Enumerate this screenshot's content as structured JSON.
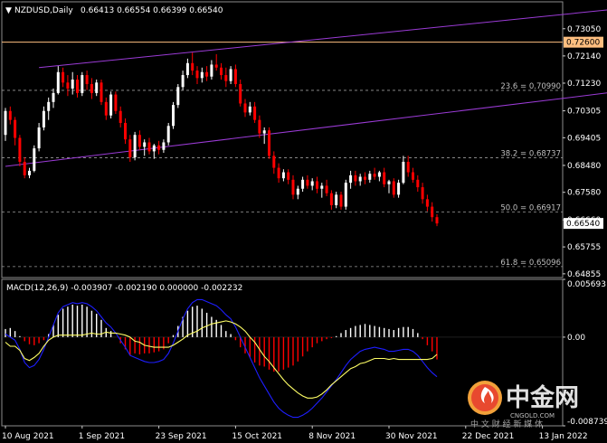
{
  "header": {
    "symbol": "NZDUSD,Daily",
    "ohlc": "0.66413 0.66554 0.66399 0.66540"
  },
  "macd_header": "MACD(12,26,9) -0.003907 -0.002190 0.000000 -0.002232",
  "colors": {
    "background": "#000000",
    "grid": "#5a5a5a",
    "bull": "#ffffff",
    "bear": "#ff0000",
    "channel": "#9b3bd6",
    "level": "#ffbf80",
    "macd_line": "#1e1eff",
    "signal_line": "#ffff66"
  },
  "watermark": {
    "brand_cn": "中金网",
    "brand_en": "CNGOLD.COM",
    "slogan": "中 文 财 经 新 媒 体",
    "icon": "flame-logo-icon"
  },
  "chart_data": {
    "type": "candlestick",
    "symbol": "NZDUSD",
    "timeframe": "Daily",
    "price_axis": {
      "ylim": [
        0.6473,
        0.7395
      ],
      "ticks": [
        "0.73050",
        "0.72140",
        "0.71230",
        "0.70305",
        "0.69405",
        "0.68480",
        "0.67580",
        "0.66660",
        "0.65755",
        "0.64855"
      ]
    },
    "current_price_label": "0.66540",
    "current_price": 0.6654,
    "level_line": {
      "label": "0.72600",
      "value": 0.726
    },
    "fibonacci": [
      {
        "label": "23.6 = 0.70990",
        "value": 0.7099
      },
      {
        "label": "38.2 = 0.68737",
        "value": 0.68737
      },
      {
        "label": "50.0 = 0.66917",
        "value": 0.66917
      },
      {
        "label": "61.8 = 0.65096",
        "value": 0.65096
      }
    ],
    "x_axis": {
      "labels": [
        "10 Aug 2021",
        "1 Sep 2021",
        "23 Sep 2021",
        "15 Oct 2021",
        "8 Nov 2021",
        "30 Nov 2021",
        "22 Dec 2021",
        "13 Jan 2022"
      ],
      "label_bars": [
        0,
        16,
        32,
        48,
        64,
        80,
        96,
        112
      ]
    },
    "channel": {
      "upper": [
        [
          7,
          0.7175
        ],
        [
          133,
          0.738
        ]
      ],
      "lower": [
        [
          0,
          0.6845
        ],
        [
          133,
          0.7105
        ]
      ]
    },
    "candles": [
      [
        0.695,
        0.704,
        0.693,
        0.703
      ],
      [
        0.703,
        0.7045,
        0.6985,
        0.7
      ],
      [
        0.7,
        0.701,
        0.6915,
        0.694
      ],
      [
        0.694,
        0.695,
        0.6845,
        0.686
      ],
      [
        0.686,
        0.6875,
        0.6805,
        0.6815
      ],
      [
        0.6815,
        0.684,
        0.6805,
        0.683
      ],
      [
        0.683,
        0.6915,
        0.6825,
        0.6905
      ],
      [
        0.6905,
        0.699,
        0.6895,
        0.6975
      ],
      [
        0.6975,
        0.7045,
        0.6965,
        0.703
      ],
      [
        0.703,
        0.7075,
        0.7,
        0.706
      ],
      [
        0.706,
        0.7105,
        0.704,
        0.709
      ],
      [
        0.709,
        0.718,
        0.7085,
        0.716
      ],
      [
        0.716,
        0.7175,
        0.711,
        0.7125
      ],
      [
        0.7125,
        0.715,
        0.708,
        0.7105
      ],
      [
        0.7105,
        0.716,
        0.7085,
        0.7135
      ],
      [
        0.7135,
        0.715,
        0.7075,
        0.709
      ],
      [
        0.709,
        0.716,
        0.708,
        0.715
      ],
      [
        0.715,
        0.7165,
        0.71,
        0.712
      ],
      [
        0.712,
        0.714,
        0.707,
        0.709
      ],
      [
        0.709,
        0.7135,
        0.708,
        0.7125
      ],
      [
        0.7125,
        0.7135,
        0.705,
        0.706
      ],
      [
        0.706,
        0.7075,
        0.7,
        0.7015
      ],
      [
        0.7015,
        0.7095,
        0.7005,
        0.7085
      ],
      [
        0.7085,
        0.7095,
        0.702,
        0.703
      ],
      [
        0.703,
        0.7045,
        0.6975,
        0.699
      ],
      [
        0.699,
        0.7005,
        0.692,
        0.6935
      ],
      [
        0.6935,
        0.695,
        0.686,
        0.6875
      ],
      [
        0.6875,
        0.696,
        0.6865,
        0.695
      ],
      [
        0.695,
        0.6965,
        0.69,
        0.691
      ],
      [
        0.691,
        0.6935,
        0.688,
        0.6925
      ],
      [
        0.6925,
        0.694,
        0.6885,
        0.6895
      ],
      [
        0.6895,
        0.692,
        0.687,
        0.6915
      ],
      [
        0.6915,
        0.693,
        0.6885,
        0.69
      ],
      [
        0.69,
        0.6935,
        0.689,
        0.6925
      ],
      [
        0.6925,
        0.699,
        0.6915,
        0.698
      ],
      [
        0.698,
        0.706,
        0.697,
        0.705
      ],
      [
        0.705,
        0.712,
        0.704,
        0.711
      ],
      [
        0.711,
        0.7165,
        0.71,
        0.715
      ],
      [
        0.715,
        0.7205,
        0.714,
        0.719
      ],
      [
        0.719,
        0.7225,
        0.715,
        0.7165
      ],
      [
        0.7165,
        0.718,
        0.712,
        0.714
      ],
      [
        0.714,
        0.7175,
        0.7125,
        0.716
      ],
      [
        0.716,
        0.718,
        0.713,
        0.7145
      ],
      [
        0.7145,
        0.72,
        0.7135,
        0.7185
      ],
      [
        0.7185,
        0.722,
        0.7165,
        0.7175
      ],
      [
        0.7175,
        0.719,
        0.7135,
        0.715
      ],
      [
        0.715,
        0.7175,
        0.711,
        0.713
      ],
      [
        0.713,
        0.718,
        0.712,
        0.717
      ],
      [
        0.717,
        0.7185,
        0.711,
        0.712
      ],
      [
        0.712,
        0.7135,
        0.7045,
        0.7055
      ],
      [
        0.7055,
        0.707,
        0.701,
        0.7025
      ],
      [
        0.7025,
        0.706,
        0.7015,
        0.7045
      ],
      [
        0.7045,
        0.706,
        0.699,
        0.7
      ],
      [
        0.7,
        0.7015,
        0.694,
        0.6955
      ],
      [
        0.6955,
        0.6975,
        0.692,
        0.6965
      ],
      [
        0.6965,
        0.6975,
        0.687,
        0.688
      ],
      [
        0.688,
        0.6895,
        0.682,
        0.684
      ],
      [
        0.684,
        0.6855,
        0.679,
        0.6805
      ],
      [
        0.6805,
        0.6835,
        0.6795,
        0.6825
      ],
      [
        0.6825,
        0.6835,
        0.6785,
        0.68
      ],
      [
        0.68,
        0.6815,
        0.6735,
        0.675
      ],
      [
        0.675,
        0.678,
        0.6735,
        0.677
      ],
      [
        0.677,
        0.681,
        0.676,
        0.68
      ],
      [
        0.68,
        0.6815,
        0.677,
        0.678
      ],
      [
        0.678,
        0.6805,
        0.6765,
        0.6795
      ],
      [
        0.6795,
        0.681,
        0.6755,
        0.677
      ],
      [
        0.677,
        0.679,
        0.674,
        0.678
      ],
      [
        0.678,
        0.68,
        0.6745,
        0.6755
      ],
      [
        0.6755,
        0.6765,
        0.67,
        0.6715
      ],
      [
        0.6715,
        0.676,
        0.6705,
        0.675
      ],
      [
        0.675,
        0.676,
        0.67,
        0.671
      ],
      [
        0.671,
        0.68,
        0.67,
        0.679
      ],
      [
        0.679,
        0.683,
        0.677,
        0.6815
      ],
      [
        0.6815,
        0.683,
        0.678,
        0.6795
      ],
      [
        0.6795,
        0.682,
        0.678,
        0.681
      ],
      [
        0.681,
        0.6825,
        0.6785,
        0.68
      ],
      [
        0.68,
        0.683,
        0.679,
        0.682
      ],
      [
        0.682,
        0.684,
        0.68,
        0.681
      ],
      [
        0.681,
        0.683,
        0.6795,
        0.6825
      ],
      [
        0.6825,
        0.684,
        0.6775,
        0.6785
      ],
      [
        0.6785,
        0.68,
        0.6755,
        0.6795
      ],
      [
        0.6795,
        0.6805,
        0.674,
        0.675
      ],
      [
        0.675,
        0.68,
        0.674,
        0.679
      ],
      [
        0.679,
        0.688,
        0.6785,
        0.686
      ],
      [
        0.686,
        0.688,
        0.681,
        0.6825
      ],
      [
        0.6825,
        0.684,
        0.679,
        0.68
      ],
      [
        0.68,
        0.6815,
        0.676,
        0.6775
      ],
      [
        0.6775,
        0.679,
        0.672,
        0.6735
      ],
      [
        0.6735,
        0.675,
        0.6695,
        0.671
      ],
      [
        0.671,
        0.6725,
        0.666,
        0.6675
      ],
      [
        0.6675,
        0.6685,
        0.6645,
        0.6654
      ]
    ],
    "macd": {
      "ylim": [
        -0.008739,
        0.005693
      ],
      "ticks": [
        "0.005693",
        "0.00",
        "-0.008739"
      ],
      "histogram": [
        0.0008,
        0.0009,
        0.0006,
        0.0001,
        -0.0004,
        -0.0007,
        -0.0008,
        -0.0006,
        -0.0003,
        0.0003,
        0.0012,
        0.0022,
        0.0028,
        0.003,
        0.0032,
        0.0031,
        0.0032,
        0.003,
        0.0026,
        0.0023,
        0.0017,
        0.0009,
        0.0006,
        0.0,
        -0.0006,
        -0.0012,
        -0.0018,
        -0.0016,
        -0.0017,
        -0.0016,
        -0.0016,
        -0.0015,
        -0.0014,
        -0.0012,
        -0.0006,
        0.0002,
        0.0011,
        0.002,
        0.0026,
        0.003,
        0.0031,
        0.0028,
        0.0024,
        0.002,
        0.0017,
        0.0012,
        0.0006,
        0.0003,
        -0.0003,
        -0.001,
        -0.0016,
        -0.002,
        -0.0025,
        -0.0028,
        -0.0029,
        -0.0032,
        -0.0034,
        -0.0034,
        -0.0032,
        -0.003,
        -0.0028,
        -0.0024,
        -0.0019,
        -0.0014,
        -0.001,
        -0.0006,
        -0.0004,
        -0.0002,
        -0.0001,
        0.0001,
        0.0004,
        0.0007,
        0.0009,
        0.0011,
        0.0012,
        0.0013,
        0.0012,
        0.0011,
        0.001,
        0.0009,
        0.0008,
        0.0007,
        0.0009,
        0.001,
        0.001,
        0.0008,
        0.0004,
        -0.0002,
        -0.0008,
        -0.0014,
        -0.0022
      ],
      "main": [
        0.0003,
        0.0,
        -0.0003,
        -0.0012,
        -0.0025,
        -0.003,
        -0.0028,
        -0.0022,
        -0.0012,
        0.0,
        0.0012,
        0.0024,
        0.003,
        0.0032,
        0.0034,
        0.0033,
        0.0034,
        0.0033,
        0.003,
        0.0026,
        0.002,
        0.0014,
        0.001,
        0.0004,
        -0.0003,
        -0.001,
        -0.0018,
        -0.002,
        -0.0022,
        -0.0024,
        -0.0025,
        -0.0025,
        -0.0024,
        -0.0022,
        -0.0016,
        -0.0006,
        0.0006,
        0.0018,
        0.0028,
        0.0034,
        0.0037,
        0.0037,
        0.0035,
        0.0033,
        0.0031,
        0.0027,
        0.0022,
        0.0018,
        0.001,
        0.0,
        -0.001,
        -0.002,
        -0.003,
        -0.004,
        -0.0048,
        -0.0056,
        -0.0064,
        -0.007,
        -0.0074,
        -0.0077,
        -0.0079,
        -0.0079,
        -0.0077,
        -0.0074,
        -0.007,
        -0.0065,
        -0.006,
        -0.0054,
        -0.0048,
        -0.0042,
        -0.0035,
        -0.0028,
        -0.0022,
        -0.0018,
        -0.0014,
        -0.0012,
        -0.0011,
        -0.001,
        -0.0011,
        -0.0012,
        -0.0014,
        -0.0014,
        -0.0013,
        -0.0012,
        -0.0012,
        -0.0014,
        -0.0018,
        -0.0024,
        -0.003,
        -0.0035,
        -0.0039
      ],
      "signal": [
        -0.0005,
        -0.0009,
        -0.0009,
        -0.0013,
        -0.0021,
        -0.0023,
        -0.002,
        -0.0016,
        -0.0009,
        -0.0003,
        0.0,
        0.0002,
        0.0002,
        0.0002,
        0.0002,
        0.0002,
        0.0002,
        0.0003,
        0.0004,
        0.0003,
        0.0003,
        0.0005,
        0.0004,
        0.0004,
        0.0003,
        0.0002,
        0.0,
        -0.0004,
        -0.0005,
        -0.0008,
        -0.0009,
        -0.001,
        -0.001,
        -0.001,
        -0.001,
        -0.0008,
        -0.0005,
        -0.0002,
        0.0002,
        0.0004,
        0.0006,
        0.0009,
        0.0011,
        0.0013,
        0.0014,
        0.0015,
        0.0016,
        0.0015,
        0.0013,
        0.001,
        0.0006,
        0.0,
        -0.0005,
        -0.0012,
        -0.0019,
        -0.0024,
        -0.003,
        -0.0036,
        -0.0042,
        -0.0047,
        -0.0051,
        -0.0055,
        -0.0058,
        -0.006,
        -0.006,
        -0.0059,
        -0.0056,
        -0.0052,
        -0.0047,
        -0.0043,
        -0.0039,
        -0.0035,
        -0.0031,
        -0.0029,
        -0.0026,
        -0.0025,
        -0.0023,
        -0.0021,
        -0.0021,
        -0.0021,
        -0.0022,
        -0.0021,
        -0.0022,
        -0.0022,
        -0.0022,
        -0.0022,
        -0.0022,
        -0.0022,
        -0.0022,
        -0.0021,
        -0.0017
      ]
    }
  }
}
